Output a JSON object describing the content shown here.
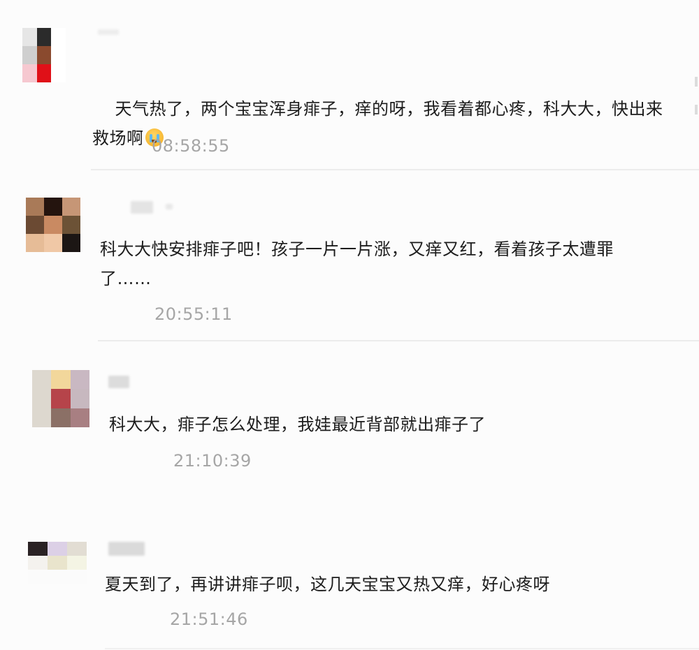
{
  "comments": [
    {
      "text": "天气热了，两个宝宝浑身痱子，痒的呀，我看着都心疼，科大大，快出来\n救场啊",
      "time": "08:58:55",
      "emoji": "crying-face-icon",
      "avatar_colors": [
        "#e6e6e6",
        "#2b2b2b",
        "#ffffff",
        "#cfcfcf",
        "#8a4a2e",
        "#ffffff",
        "#f6c8d0",
        "#e01018",
        "#ffffff"
      ]
    },
    {
      "text": "科大大快安排痱子吧！孩子一片一片涨，又痒又红，看着孩子太遭罪\n了……",
      "time": "20:55:11",
      "avatar_colors": [
        "#a97a58",
        "#24140e",
        "#c69676",
        "#6b4a33",
        "#c98a62",
        "#6c5236",
        "#e6bc97",
        "#f0c8a6",
        "#1c1614"
      ]
    },
    {
      "text": "科大大，痱子怎么处理，我娃最近背部就出痱子了",
      "time": "21:10:39",
      "avatar_colors": [
        "#ddd8cf",
        "#f2d79b",
        "#c9b8c2",
        "#ddd8cf",
        "#b6444a",
        "#c7b8bf",
        "#ddd8cf",
        "#8b7066",
        "#a87f82"
      ]
    },
    {
      "text": "夏天到了，再讲讲痱子呗，这几天宝宝又热又痒，好心疼呀",
      "time": "21:51:46",
      "avatar_colors": [
        "#2a2224",
        "#dcd0e6",
        "#e2ddd3",
        "#f4f2ee",
        "#e9e4cc",
        "#f4f4e4",
        "#fbfbfb",
        "#fbfbfb",
        "#fbfbfb"
      ]
    }
  ]
}
